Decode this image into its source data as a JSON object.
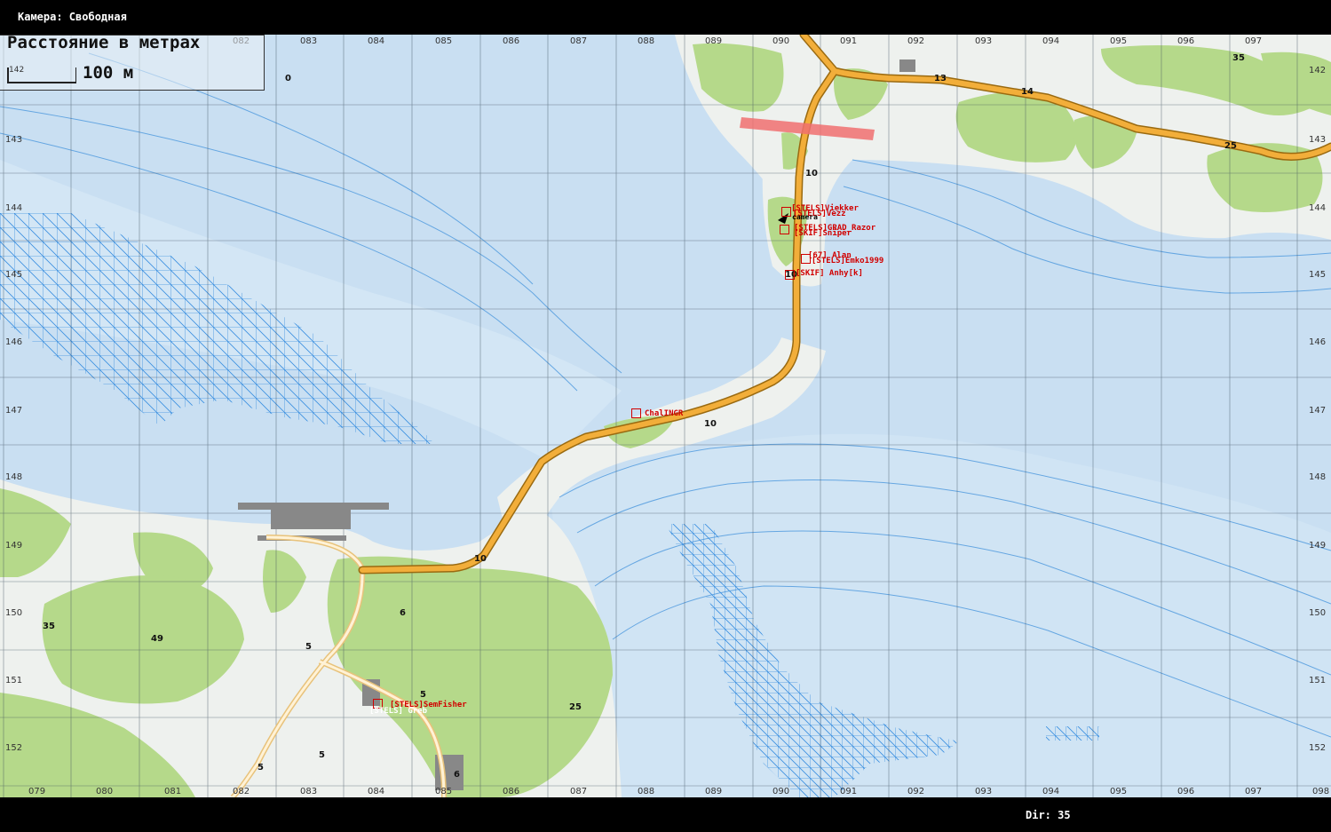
{
  "header": {
    "camera_label": "Камера: Свободная"
  },
  "footer": {
    "direction_label": "Dir: 35"
  },
  "scale": {
    "title": "Расстояние в метрах",
    "value": "100 м",
    "hidden_coord": "142"
  },
  "grid": {
    "top_x": [
      "082",
      "083",
      "084",
      "085",
      "086",
      "087",
      "088",
      "089",
      "090",
      "091",
      "092",
      "093",
      "094",
      "095",
      "096",
      "097"
    ],
    "bottom_x": [
      "079",
      "080",
      "081",
      "082",
      "083",
      "084",
      "085",
      "086",
      "087",
      "088",
      "089",
      "090",
      "091",
      "092",
      "093",
      "094",
      "095",
      "096",
      "097",
      "098"
    ],
    "left_y": [
      "143",
      "144",
      "145",
      "146",
      "147",
      "148",
      "149",
      "150",
      "151",
      "152"
    ],
    "right_y": [
      "142",
      "143",
      "144",
      "145",
      "146",
      "147",
      "148",
      "149",
      "150",
      "151",
      "152"
    ]
  },
  "heights": [
    "0",
    "35",
    "13",
    "14",
    "25",
    "10",
    "10",
    "10",
    "10",
    "6",
    "35",
    "49",
    "5",
    "5",
    "25",
    "5",
    "5",
    "6"
  ],
  "units": [
    {
      "name": "[STELS]Viekker"
    },
    {
      "name": "[STELS]Vezz"
    },
    {
      "name": "[STELS]GRAD_Razor"
    },
    {
      "name": "[SKIF]Sniper"
    },
    {
      "name": "[67] Alan"
    },
    {
      "name": "[STELS]Emko1999"
    },
    {
      "name": "[SKIF] Anhy[k]"
    },
    {
      "name": "ChalINGR"
    },
    {
      "name": "[STELS]SemFisher"
    },
    {
      "name": "[STELS] Greb"
    }
  ],
  "camera": {
    "label": "camera"
  },
  "colors": {
    "water": "#c9dff2",
    "land": "#eef1ee",
    "forest": "#b5d98a",
    "road_main": "#f2ae3a",
    "marker": "#d10000",
    "grid": "#3a4a5a"
  }
}
